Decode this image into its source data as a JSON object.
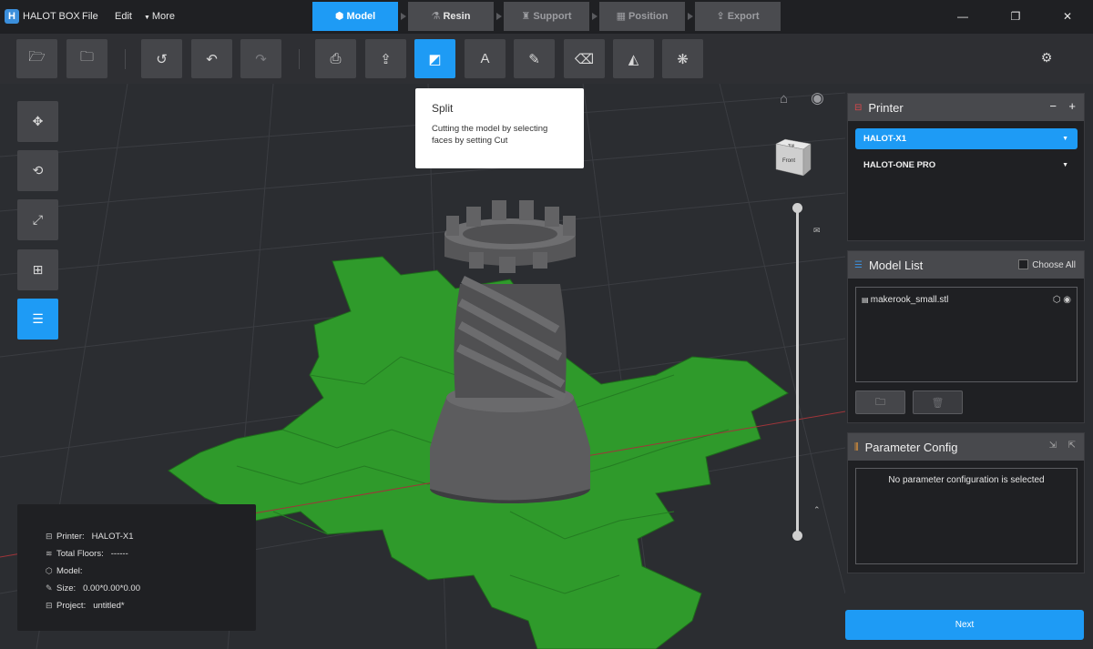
{
  "app": {
    "title": "HALOT BOX",
    "logo_letter": "H"
  },
  "menu": {
    "file": "File",
    "edit": "Edit",
    "more": "More"
  },
  "steps": [
    {
      "label": "Model",
      "icon": "cube-icon",
      "glyph": "⬢"
    },
    {
      "label": "Resin",
      "icon": "resin-icon",
      "glyph": "⚗"
    },
    {
      "label": "Support",
      "icon": "support-icon",
      "glyph": "♜"
    },
    {
      "label": "Position",
      "icon": "grid-icon",
      "glyph": "▦"
    },
    {
      "label": "Export",
      "icon": "export-icon",
      "glyph": "⇪"
    }
  ],
  "window": {
    "minimize": "—",
    "restore": "❐",
    "close": "✕"
  },
  "tooltip": {
    "title": "Split",
    "body": "Cutting the model by selecting faces by setting Cut"
  },
  "info": {
    "printer_label": "Printer:",
    "printer_value": "HALOT-X1",
    "floors_label": "Total Floors:",
    "floors_value": "------",
    "model_label": "Model:",
    "model_value": "",
    "size_label": "Size:",
    "size_value": "0.00*0.00*0.00",
    "project_label": "Project:",
    "project_value": "untitled*"
  },
  "view_cube": {
    "top": "Top",
    "front": "Front"
  },
  "printer_panel": {
    "title": "Printer",
    "minus": "−",
    "plus": "+",
    "selected": "HALOT-X1",
    "other": "HALOT-ONE PRO"
  },
  "model_list_panel": {
    "title": "Model List",
    "choose_all": "Choose All",
    "items": [
      "makerook_small.stl"
    ]
  },
  "param_panel": {
    "title": "Parameter Config",
    "empty_text": "No parameter configuration is selected"
  },
  "next_label": "Next",
  "colors": {
    "accent": "#1e9bf5",
    "plate": "#2f9a2b",
    "model": "#5a5a5c"
  }
}
